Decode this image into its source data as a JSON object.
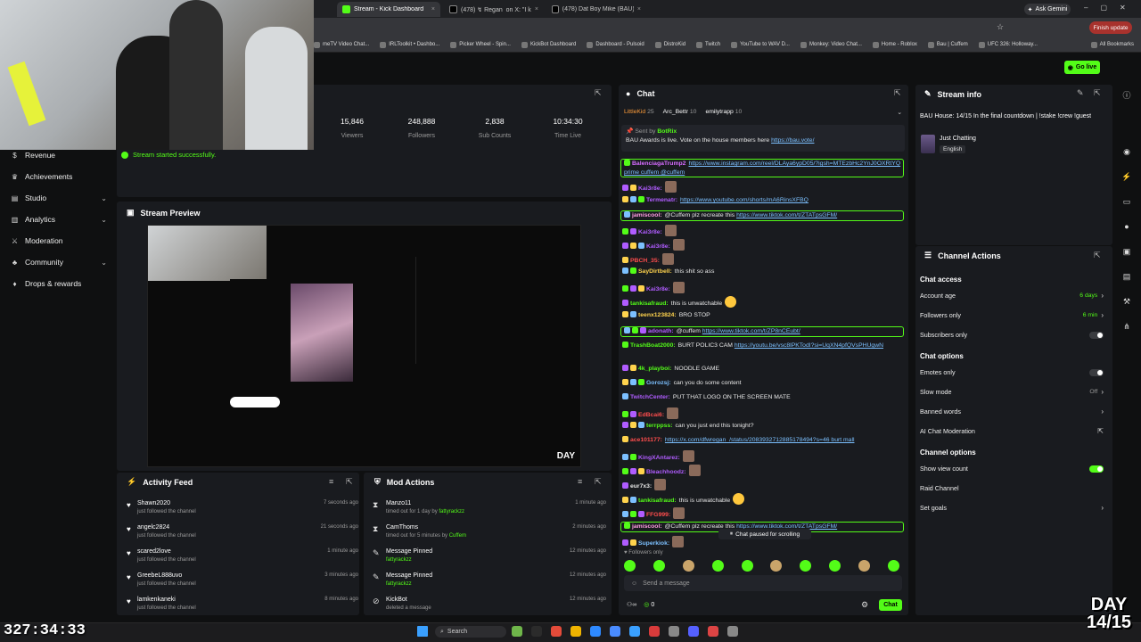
{
  "browser": {
    "tabs": [
      {
        "label": "Stream - Kick Dashboard",
        "active": true
      },
      {
        "label": "(478) ↯ Regan ⁠ on X: \"I k",
        "active": false
      },
      {
        "label": "(478) Dat Boy Mike (BAU) BAN",
        "active": false
      }
    ],
    "ask_gemini": "Ask Gemini",
    "finish_update": "Finish update",
    "bookmarks": [
      "meTV Video Chat...",
      "IRLToolkit • Dashbo...",
      "Picker Wheel - Spin...",
      "KickBot Dashboard",
      "Dashboard - Pulsoid",
      "DistroKid",
      "Twitch",
      "YouTube to WAV D...",
      "Monkey: Video Chat...",
      "Home - Roblox",
      "Bau | Cuffem",
      "UFC 326: Holloway..."
    ],
    "all_bookmarks": "All Bookmarks"
  },
  "header": {
    "go_live": "Go live"
  },
  "sidebar": {
    "items": [
      {
        "label": "Revenue",
        "icon": "dollar-icon",
        "chevron": false
      },
      {
        "label": "Achievements",
        "icon": "trophy-icon",
        "chevron": false
      },
      {
        "label": "Studio",
        "icon": "studio-icon",
        "chevron": true
      },
      {
        "label": "Analytics",
        "icon": "analytics-icon",
        "chevron": true
      },
      {
        "label": "Moderation",
        "icon": "sword-icon",
        "chevron": false
      },
      {
        "label": "Community",
        "icon": "community-icon",
        "chevron": true
      },
      {
        "label": "Drops & rewards",
        "icon": "gift-icon",
        "chevron": false
      }
    ]
  },
  "stats": [
    {
      "value": "15,846",
      "label": "Viewers"
    },
    {
      "value": "248,888",
      "label": "Followers"
    },
    {
      "value": "2,838",
      "label": "Sub Counts"
    },
    {
      "value": "10:34:30",
      "label": "Time Live"
    }
  ],
  "toast": "Stream started successfully.",
  "preview": {
    "title": "Stream Preview",
    "watermark": "DAY"
  },
  "activity": {
    "title": "Activity Feed",
    "rows": [
      {
        "name": "Shawn2020",
        "sub": "just followed the channel",
        "time": "7 seconds ago"
      },
      {
        "name": "angelc2824",
        "sub": "just followed the channel",
        "time": "21 seconds ago"
      },
      {
        "name": "scared2love",
        "sub": "just followed the channel",
        "time": "1 minute ago"
      },
      {
        "name": "GreebeL888uvo",
        "sub": "just followed the channel",
        "time": "3 minutes ago"
      },
      {
        "name": "lamkenkaneki",
        "sub": "just followed the channel",
        "time": "8 minutes ago"
      }
    ]
  },
  "mod": {
    "title": "Mod Actions",
    "rows": [
      {
        "icon": "hourglass-icon",
        "name": "Manzo11",
        "sub": "timed out for 1 day by",
        "by": "fattyrackzz",
        "time": "1 minute ago"
      },
      {
        "icon": "hourglass-icon",
        "name": "CamThoms",
        "sub": "timed out for 5 minutes by",
        "by": "Cuffem",
        "time": "2 minutes ago"
      },
      {
        "icon": "pin-icon",
        "name": "Message Pinned",
        "sub": "",
        "by": "fattyrackzz",
        "time": "12 minutes ago"
      },
      {
        "icon": "pin-icon",
        "name": "Message Pinned",
        "sub": "",
        "by": "fattyrackzz",
        "time": "12 minutes ago"
      },
      {
        "icon": "ban-icon",
        "name": "KickBot",
        "sub": "deleted a message",
        "by": "",
        "time": "12 minutes ago"
      }
    ]
  },
  "chat": {
    "title": "Chat",
    "top_chatters": [
      {
        "name": "LittleKid",
        "count": "25"
      },
      {
        "name": "Arc_Bettr",
        "count": "10"
      },
      {
        "name": "emilytrapp",
        "count": "10"
      }
    ],
    "pinned_by": "Sent by",
    "pinned_author": "BotRix",
    "pinned_text": "BAU Awards is live. Vote on the house members here",
    "pinned_link": "https://bau.vote/",
    "messages": [
      {
        "user": "BalenciagaTrump2",
        "color": "#d66bff",
        "text": "",
        "link": "https://www.instagram.com/reel/DLAya6ypD05/?igsh=MTEzbHc2YnJ0OXRtYQ prime cuffem @cuffem",
        "hl": true
      },
      {
        "user": "Kai3r8e:",
        "color": "#b05cff",
        "text": "",
        "link": "",
        "hl": false
      },
      {
        "user": "Termenatr:",
        "color": "#b05cff",
        "text": "",
        "link": "https://www.youtube.com/shorts/mA6RinsXFBQ",
        "hl": false
      },
      {
        "user": "jamiscool:",
        "color": "#ff9de2",
        "text": "@Cuffem plz recreate this",
        "link": "https://www.tiktok.com/t/ZTATpsGFM/",
        "hl": true
      },
      {
        "user": "Kai3r8e:",
        "color": "#b05cff",
        "text": "",
        "link": "",
        "hl": false
      },
      {
        "user": "Kai3r8e:",
        "color": "#b05cff",
        "text": "",
        "link": "",
        "hl": false
      },
      {
        "user": "PBCH_35:",
        "color": "#ff4d4d",
        "text": "",
        "link": "",
        "hl": false
      },
      {
        "user": "SayDirtbell:",
        "color": "#ffd34d",
        "text": "this shit so ass",
        "link": "",
        "hl": false
      },
      {
        "user": "Kai3r8e:",
        "color": "#b05cff",
        "text": "",
        "link": "",
        "hl": false
      },
      {
        "user": "tankisafraud:",
        "color": "#53fc18",
        "text": "this is unwatchable",
        "link": "",
        "hl": false
      },
      {
        "user": "teenx123824:",
        "color": "#ffd34d",
        "text": "BRO STOP",
        "link": "",
        "hl": false
      },
      {
        "user": "adonath:",
        "color": "#b05cff",
        "text": "@cuffem",
        "link": "https://www.tiktok.com/t/ZP8nCEubt/",
        "hl": true
      },
      {
        "user": "TrashBoat2000:",
        "color": "#53fc18",
        "text": "BURT POLIC3 CAM",
        "link": "https://youtu.be/vsc8lPKTodI?si=UqXN4pfQVsPHUgwN",
        "hl": false
      },
      {
        "user": "4k_playboi:",
        "color": "#53fc18",
        "text": "NOODLE GAME",
        "link": "",
        "hl": false
      },
      {
        "user": "Gorozsj:",
        "color": "#7cc0ff",
        "text": "can you do some content",
        "link": "",
        "hl": false
      },
      {
        "user": "TwitchCenter:",
        "color": "#b05cff",
        "text": "PUT THAT LOGO ON THE SCREEN MATE",
        "link": "",
        "hl": false
      },
      {
        "user": "EdBcai6:",
        "color": "#ff4d4d",
        "text": "",
        "link": "",
        "hl": false
      },
      {
        "user": "terrppss:",
        "color": "#53fc18",
        "text": "can you just end this tonight?",
        "link": "",
        "hl": false
      },
      {
        "user": "ace101177:",
        "color": "#ff4d4d",
        "text": "",
        "link": "https://x.com/dfwregan_/status/2083932712885178494?s=46 burt mall",
        "hl": false
      },
      {
        "user": "KingXAntarez:",
        "color": "#b05cff",
        "text": "",
        "link": "",
        "hl": false
      },
      {
        "user": "Bleachhoodz:",
        "color": "#b05cff",
        "text": "",
        "link": "",
        "hl": false
      },
      {
        "user": "eur7x3:",
        "color": "#e8e8e8",
        "text": "",
        "link": "",
        "hl": false
      },
      {
        "user": "tankisafraud:",
        "color": "#53fc18",
        "text": "this is unwatchable",
        "link": "",
        "hl": false
      },
      {
        "user": "FFG999:",
        "color": "#ff4d4d",
        "text": "",
        "link": "",
        "hl": false
      },
      {
        "user": "jamiscool:",
        "color": "#ff9de2",
        "text": "@Cuffem plz recreate this",
        "link": "https://www.tiktok.com/t/ZTATpsGFM/",
        "hl": true
      },
      {
        "user": "Superkiok:",
        "color": "#7cc0ff",
        "text": "",
        "link": "",
        "hl": false
      }
    ],
    "paused": "Chat paused for scrolling",
    "followers_only": "Followers only",
    "placeholder": "Send a message",
    "count": "0",
    "send": "Chat"
  },
  "stream_info": {
    "title": "Stream info",
    "text": "BAU House: 14/15 In the final countdown | !stake !crew !guest",
    "category": "Just Chatting",
    "language": "English"
  },
  "channel_actions": {
    "title": "Channel Actions",
    "sections": [
      {
        "heading": "Chat access",
        "rows": [
          {
            "label": "Account age",
            "value": "6 days",
            "kind": "arrow"
          },
          {
            "label": "Followers only",
            "value": "6 min",
            "kind": "arrow"
          },
          {
            "label": "Subscribers only",
            "value": "",
            "kind": "toggle-off"
          }
        ]
      },
      {
        "heading": "Chat options",
        "rows": [
          {
            "label": "Emotes only",
            "value": "",
            "kind": "toggle-off"
          },
          {
            "label": "Slow mode",
            "value": "Off",
            "kind": "arrow-grey"
          },
          {
            "label": "Banned words",
            "value": "",
            "kind": "arrow"
          },
          {
            "label": "AI Chat Moderation",
            "value": "",
            "kind": "external"
          }
        ]
      },
      {
        "heading": "Channel options",
        "rows": [
          {
            "label": "Show view count",
            "value": "",
            "kind": "toggle-on"
          },
          {
            "label": "Raid Channel",
            "value": "",
            "kind": "none"
          },
          {
            "label": "Set goals",
            "value": "",
            "kind": "arrow"
          }
        ]
      }
    ]
  },
  "overlay": {
    "timer": "327:34:33",
    "day": "DAY",
    "day_count": "14/15"
  },
  "taskbar": {
    "search": "Search"
  },
  "colors": {
    "accent": "#53fc18",
    "panel": "#191b1f",
    "bg": "#0f1011"
  }
}
